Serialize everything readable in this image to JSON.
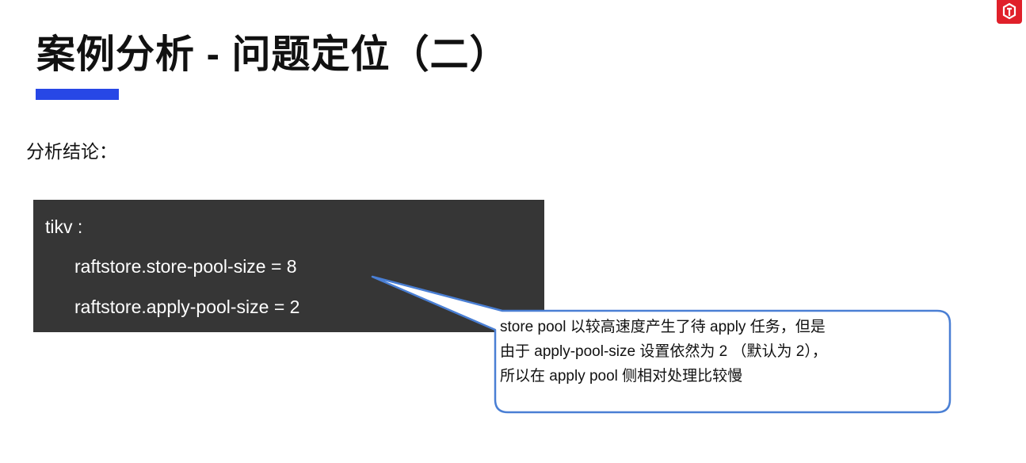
{
  "slide": {
    "title": "案例分析 - 问题定位（二）",
    "subtitle": "分析结论："
  },
  "code": {
    "lines": [
      "tikv :",
      "raftstore.store-pool-size = 8",
      "raftstore.apply-pool-size = 2"
    ]
  },
  "callout": {
    "lines": [
      " store pool 以较高速度产生了待 apply 任务，但是",
      "由于 apply-pool-size 设置依然为 2 （默认为 2），",
      "所以在 apply pool 侧相对处理比较慢"
    ]
  },
  "icons": {
    "logo": "brand-logo-icon"
  },
  "colors": {
    "accent_bar": "#2747e6",
    "code_background": "#363636",
    "callout_border": "#4a7fd4",
    "logo": "#e0202a"
  }
}
